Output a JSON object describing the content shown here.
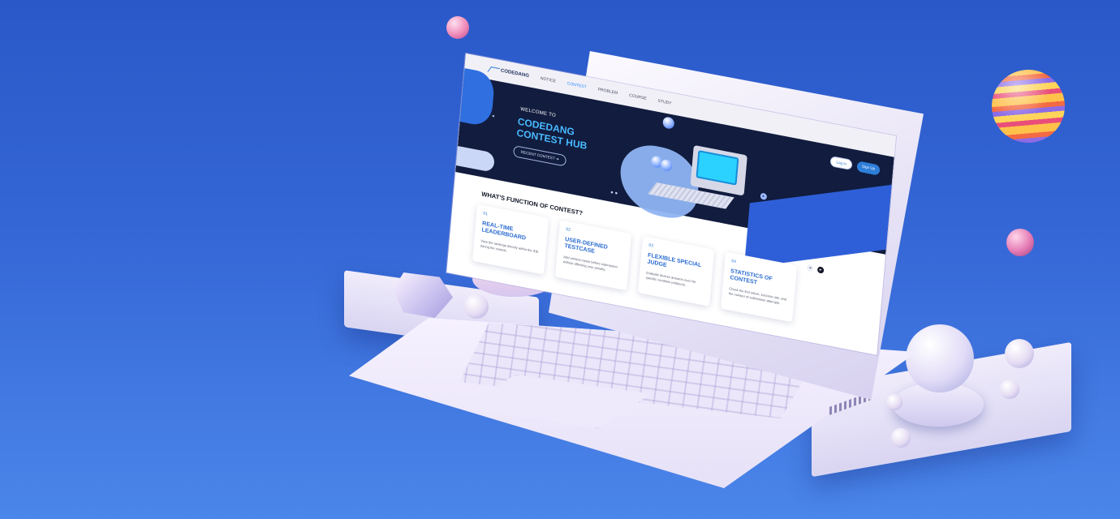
{
  "nav": {
    "logo": "CODEDANG",
    "items": [
      "NOTICE",
      "CONTEST",
      "PROBLEM",
      "COURSE",
      "STUDY"
    ],
    "active": "CONTEST",
    "login": "Log In",
    "signup": "Sign Up"
  },
  "hero": {
    "welcome": "WELCOME TO",
    "title": "CODEDANG CONTEST HUB",
    "button": "RECENT CONTEST",
    "button_icon": "arrow-right-icon",
    "slide_prev_icon": "chevron-left-icon",
    "slide_next_icon": "chevron-right-icon"
  },
  "section": {
    "title": "WHAT'S FUNCTION OF CONTEST?"
  },
  "cards": [
    {
      "num": "01",
      "title": "REAL-TIME LEADERBOARD",
      "desc": "View the rankings directly within the IDE during the contest."
    },
    {
      "num": "02",
      "title": "USER-DEFINED TESTCASE",
      "desc": "Add various inputs before submission without affecting your penalty."
    },
    {
      "num": "03",
      "title": "FLEXIBLE SPECIAL JUDGE",
      "desc": "Evaluate diverse answers even for specific condition problems."
    },
    {
      "num": "04",
      "title": "STATISTICS OF CONTEST",
      "desc": "Check the first solver, success rate, and the number of submission attempts."
    }
  ],
  "carousel": {
    "prev_icon": "chevron-left-icon",
    "next_icon": "chevron-right-icon"
  },
  "colors": {
    "accent": "#2f8cff",
    "hero_bg": "#111c3e",
    "hero_title": "#49b9ff",
    "background": "#3567d6"
  }
}
